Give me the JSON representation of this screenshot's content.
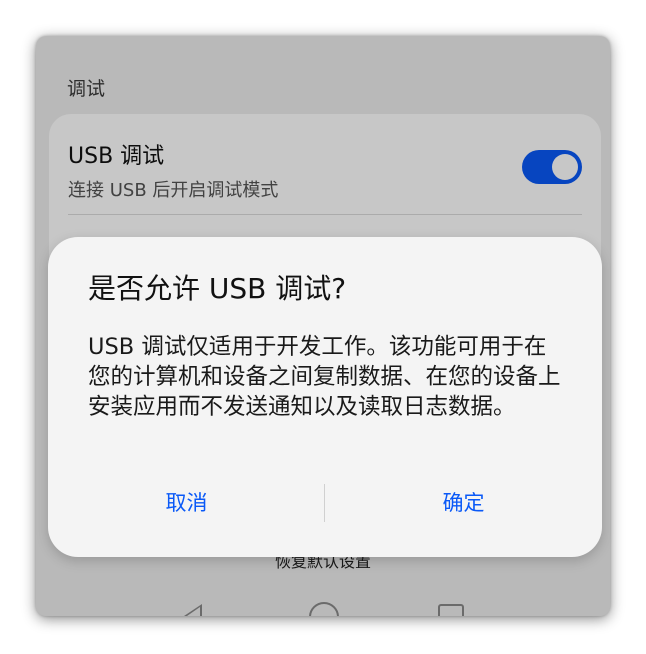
{
  "settings": {
    "section_title": "调试",
    "usb_debug": {
      "title": "USB 调试",
      "subtitle": "连接 USB 后开启调试模式",
      "enabled": true
    },
    "restore_defaults_label": "恢复默认设置"
  },
  "dialog": {
    "title": "是否允许 USB 调试?",
    "message": "USB 调试仅适用于开发工作。该功能可用于在您的计算机和设备之间复制数据、在您的设备上安装应用而不发送通知以及读取日志数据。",
    "cancel_label": "取消",
    "confirm_label": "确定"
  },
  "navigation": {
    "icons": [
      "back-icon",
      "home-icon",
      "recent-apps-icon"
    ]
  },
  "colors": {
    "accent": "#0a59f7",
    "dialog_background": "#f4f4f4",
    "page_background": "#ededed"
  }
}
